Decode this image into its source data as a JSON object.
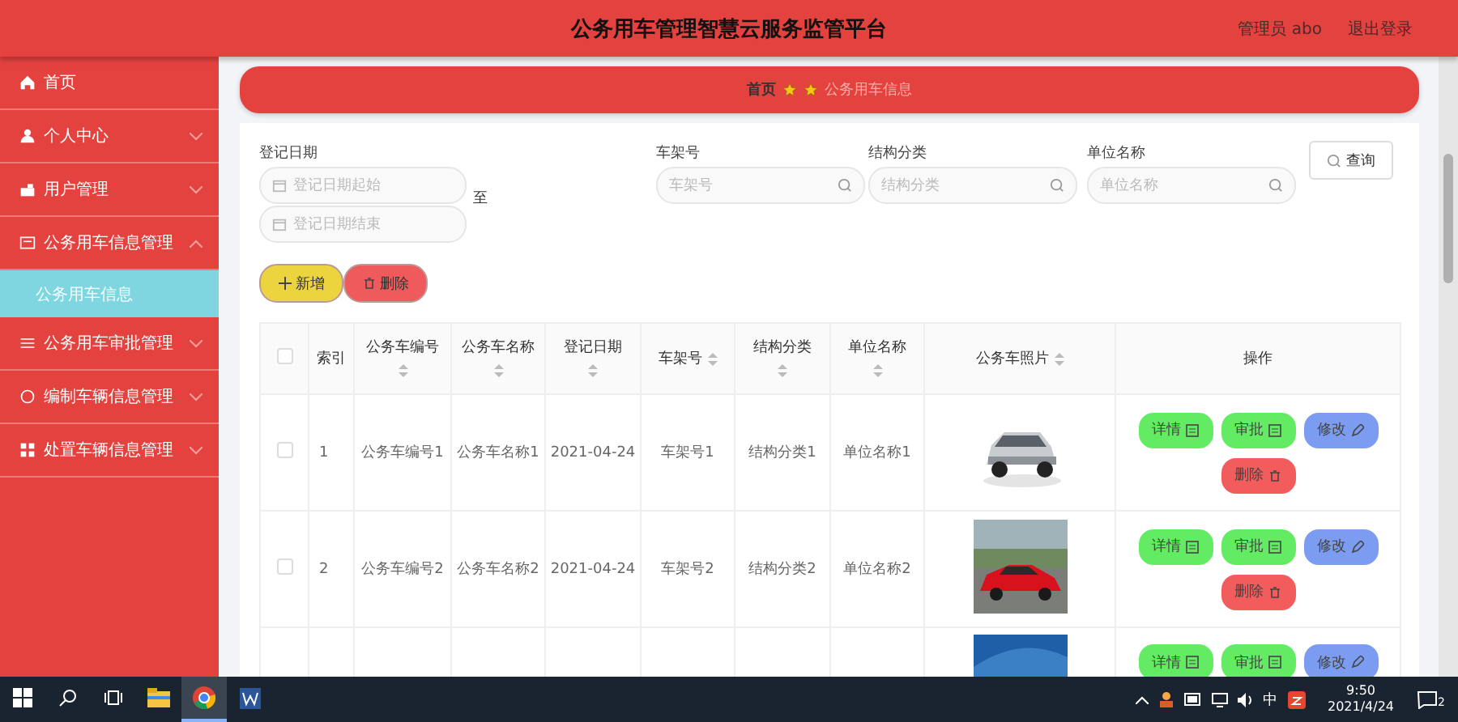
{
  "header": {
    "title": "公务用车管理智慧云服务监管平台",
    "user": "管理员 abo",
    "logout": "退出登录"
  },
  "sidebar": {
    "items": [
      {
        "label": "首页"
      },
      {
        "label": "个人中心",
        "expanded": false
      },
      {
        "label": "用户管理",
        "expanded": false
      },
      {
        "label": "公务用车信息管理",
        "expanded": true,
        "children": [
          {
            "label": "公务用车信息",
            "selected": true
          }
        ]
      },
      {
        "label": "公务用车审批管理",
        "expanded": false
      },
      {
        "label": "编制车辆信息管理",
        "expanded": false
      },
      {
        "label": "处置车辆信息管理",
        "expanded": false
      }
    ]
  },
  "breadcrumb": {
    "home": "首页",
    "current": "公务用车信息"
  },
  "search": {
    "date_label": "登记日期",
    "date_start": {
      "placeholder": "登记日期起始"
    },
    "date_end": {
      "placeholder": "登记日期结束"
    },
    "separator": "至",
    "fields": [
      {
        "label": "车架号",
        "placeholder": "车架号"
      },
      {
        "label": "结构分类",
        "placeholder": "结构分类"
      },
      {
        "label": "单位名称",
        "placeholder": "单位名称"
      }
    ],
    "button": "查询"
  },
  "toolbar": [
    {
      "label": "新增",
      "kind": "add"
    },
    {
      "label": "删除",
      "kind": "delete"
    }
  ],
  "table": {
    "select_all_checked": false,
    "columns": [
      {
        "label": "索引",
        "sortable": false
      },
      {
        "label": "公务车编号",
        "sortable": true
      },
      {
        "label": "公务车名称",
        "sortable": true
      },
      {
        "label": "登记日期",
        "sortable": true
      },
      {
        "label": "车架号",
        "sortable": true
      },
      {
        "label": "结构分类",
        "sortable": true
      },
      {
        "label": "单位名称",
        "sortable": true
      },
      {
        "label": "公务车照片",
        "sortable": true
      },
      {
        "label": "操作",
        "sortable": false
      }
    ],
    "rows": [
      {
        "checked": false,
        "cells": [
          "1",
          "公务车编号1",
          "公务车名称1",
          "2021-04-24",
          "车架号1",
          "结构分类1",
          "单位名称1"
        ],
        "actions": [
          {
            "label": "详情",
            "kind": "detail"
          },
          {
            "label": "审批",
            "kind": "approve"
          },
          {
            "label": "修改",
            "kind": "edit"
          },
          {
            "label": "删除",
            "kind": "delete"
          }
        ]
      },
      {
        "checked": false,
        "cells": [
          "2",
          "公务车编号2",
          "公务车名称2",
          "2021-04-24",
          "车架号2",
          "结构分类2",
          "单位名称2"
        ],
        "actions": [
          {
            "label": "详情",
            "kind": "detail"
          },
          {
            "label": "审批",
            "kind": "approve"
          },
          {
            "label": "修改",
            "kind": "edit"
          },
          {
            "label": "删除",
            "kind": "delete"
          }
        ]
      },
      {
        "actions": [
          {
            "label": "详情",
            "kind": "detail"
          },
          {
            "label": "审批",
            "kind": "approve"
          },
          {
            "label": "修改",
            "kind": "edit"
          }
        ]
      }
    ]
  },
  "taskbar": {
    "apps": [
      {
        "selected": false
      },
      {
        "selected": true
      },
      {
        "selected": false
      }
    ],
    "ime": "中",
    "time": "9:50",
    "date": "2021/4/24",
    "notifications": "2"
  }
}
